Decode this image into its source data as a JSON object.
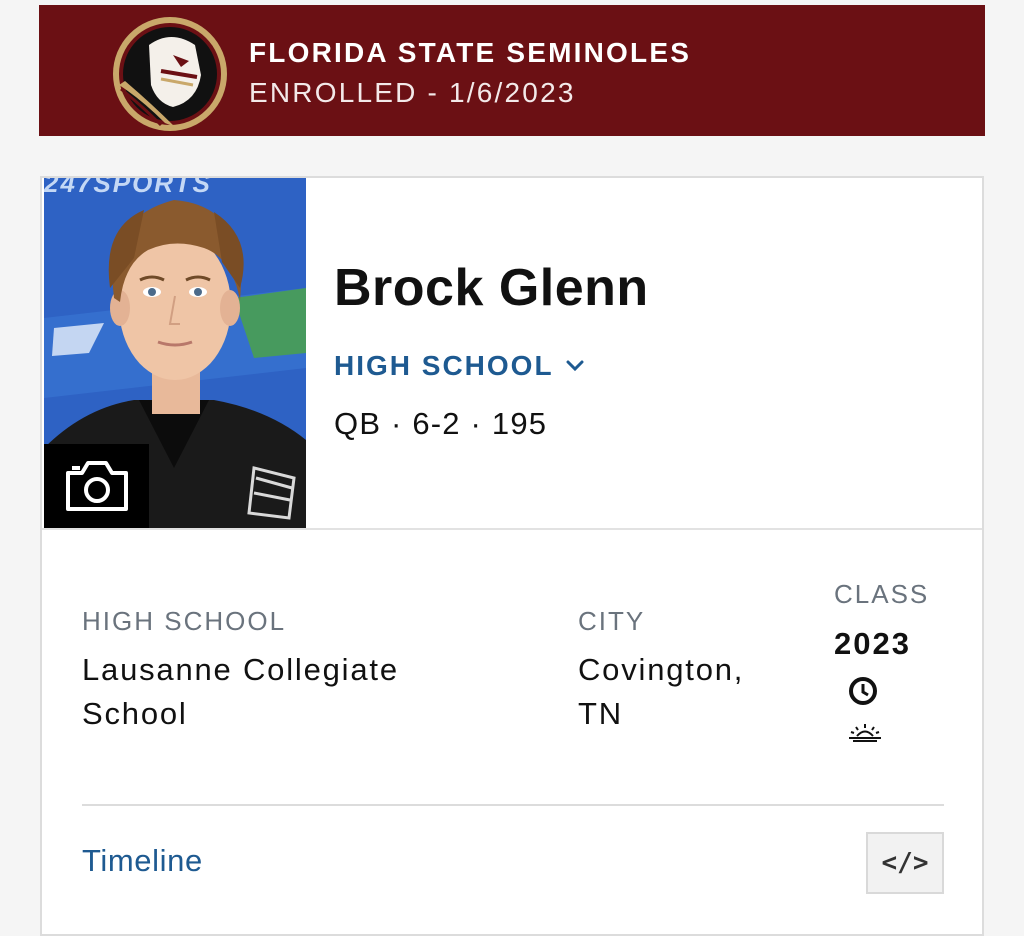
{
  "banner": {
    "title": "FLORIDA STATE SEMINOLES",
    "status": "ENROLLED - 1/6/2023",
    "bg_color": "#6b1014"
  },
  "player": {
    "name": "Brock Glenn",
    "school_dropdown_label": "HIGH SCHOOL",
    "measurables": "QB · 6-2 · 195",
    "photo_brand_text": "247SPORTS"
  },
  "info": {
    "high_school_label": "HIGH SCHOOL",
    "high_school_value": "Lausanne Collegiate School",
    "city_label": "CITY",
    "city_value": "Covington, TN",
    "class_label": "CLASS",
    "class_value": "2023"
  },
  "footer": {
    "timeline_label": "Timeline",
    "embed_label": "</>"
  },
  "colors": {
    "accent_link": "#1e5a91",
    "label_gray": "#6a737d"
  },
  "icons": [
    "seminoles-logo-icon",
    "camera-icon",
    "chevron-down-icon",
    "clock-icon",
    "sunrise-icon",
    "embed-code-icon"
  ]
}
